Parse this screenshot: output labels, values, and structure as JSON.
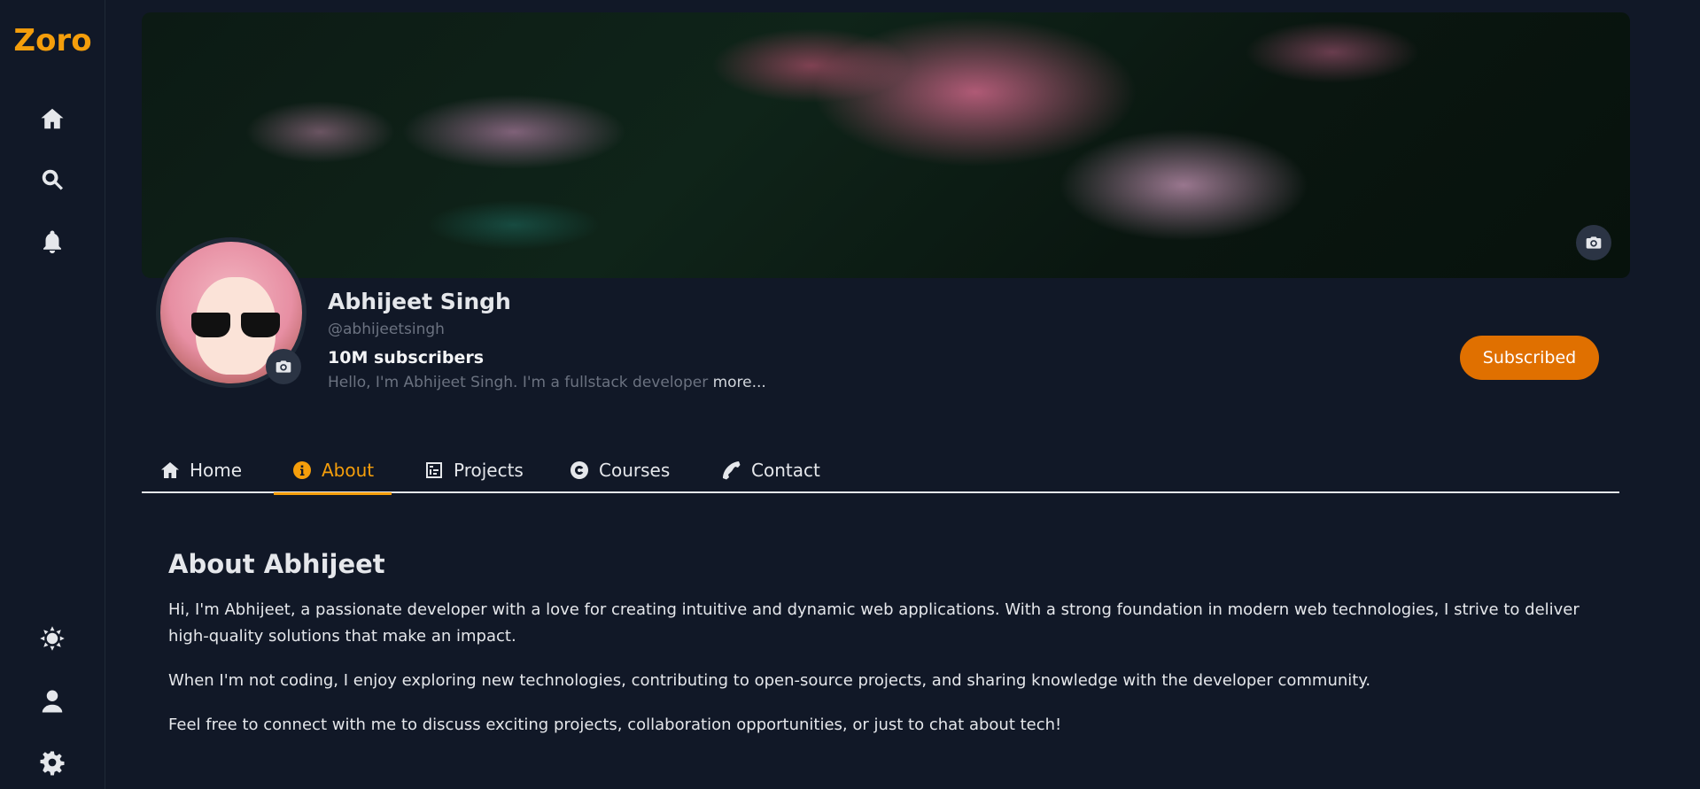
{
  "app": {
    "logo": "Zoro"
  },
  "sidebar": {
    "top_icons": [
      "home-icon",
      "search-icon",
      "bell-icon"
    ],
    "bottom_icons": [
      "theme-sun-icon",
      "user-icon",
      "gear-icon"
    ]
  },
  "profile": {
    "name": "Abhijeet Singh",
    "handle": "@abhijeetsingh",
    "subscribers": "10M subscribers",
    "bio": "Hello, I'm Abhijeet Singh. I'm a fullstack developer",
    "more_label": "more...",
    "subscribe_label": "Subscribed"
  },
  "tabs": [
    {
      "label": "Home",
      "icon": "home-icon"
    },
    {
      "label": "About",
      "icon": "info-icon",
      "active": true
    },
    {
      "label": "Projects",
      "icon": "projects-icon"
    },
    {
      "label": "Courses",
      "icon": "courses-icon"
    },
    {
      "label": "Contact",
      "icon": "phone-icon"
    }
  ],
  "about": {
    "title": "About Abhijeet",
    "paragraphs": [
      "Hi, I'm Abhijeet, a passionate developer with a love for creating intuitive and dynamic web applications. With a strong foundation in modern web technologies, I strive to deliver high-quality solutions that make an impact.",
      "When I'm not coding, I enjoy exploring new technologies, contributing to open-source projects, and sharing knowledge with the developer community.",
      "Feel free to connect with me to discuss exciting projects, collaboration opportunities, or just to chat about tech!"
    ]
  },
  "colors": {
    "accent": "#f59e0b",
    "button": "#e07000",
    "background": "#111827"
  }
}
